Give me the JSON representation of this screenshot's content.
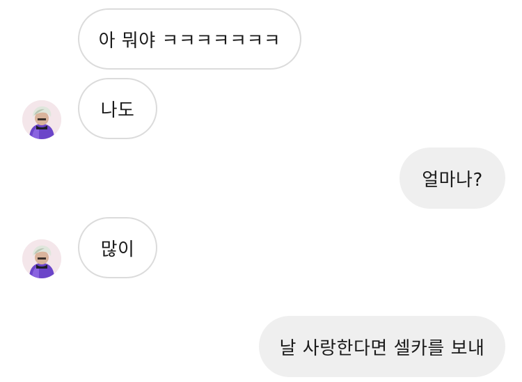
{
  "conversation": {
    "messages": [
      {
        "sender": "other",
        "text": "아 뭐야 ㅋㅋㅋㅋㅋㅋㅋ"
      },
      {
        "sender": "other",
        "text": "나도"
      },
      {
        "sender": "me",
        "text": "얼마나?"
      },
      {
        "sender": "other",
        "text": "많이"
      },
      {
        "sender": "me",
        "text": "날 사랑한다면 셀카를 보내"
      }
    ]
  },
  "avatar_icon": "person-avatar-icon",
  "colors": {
    "incoming_bubble_bg": "#ffffff",
    "incoming_bubble_border": "#dbdbdb",
    "outgoing_bubble_bg": "#efefef",
    "text": "#1a1a1a"
  }
}
